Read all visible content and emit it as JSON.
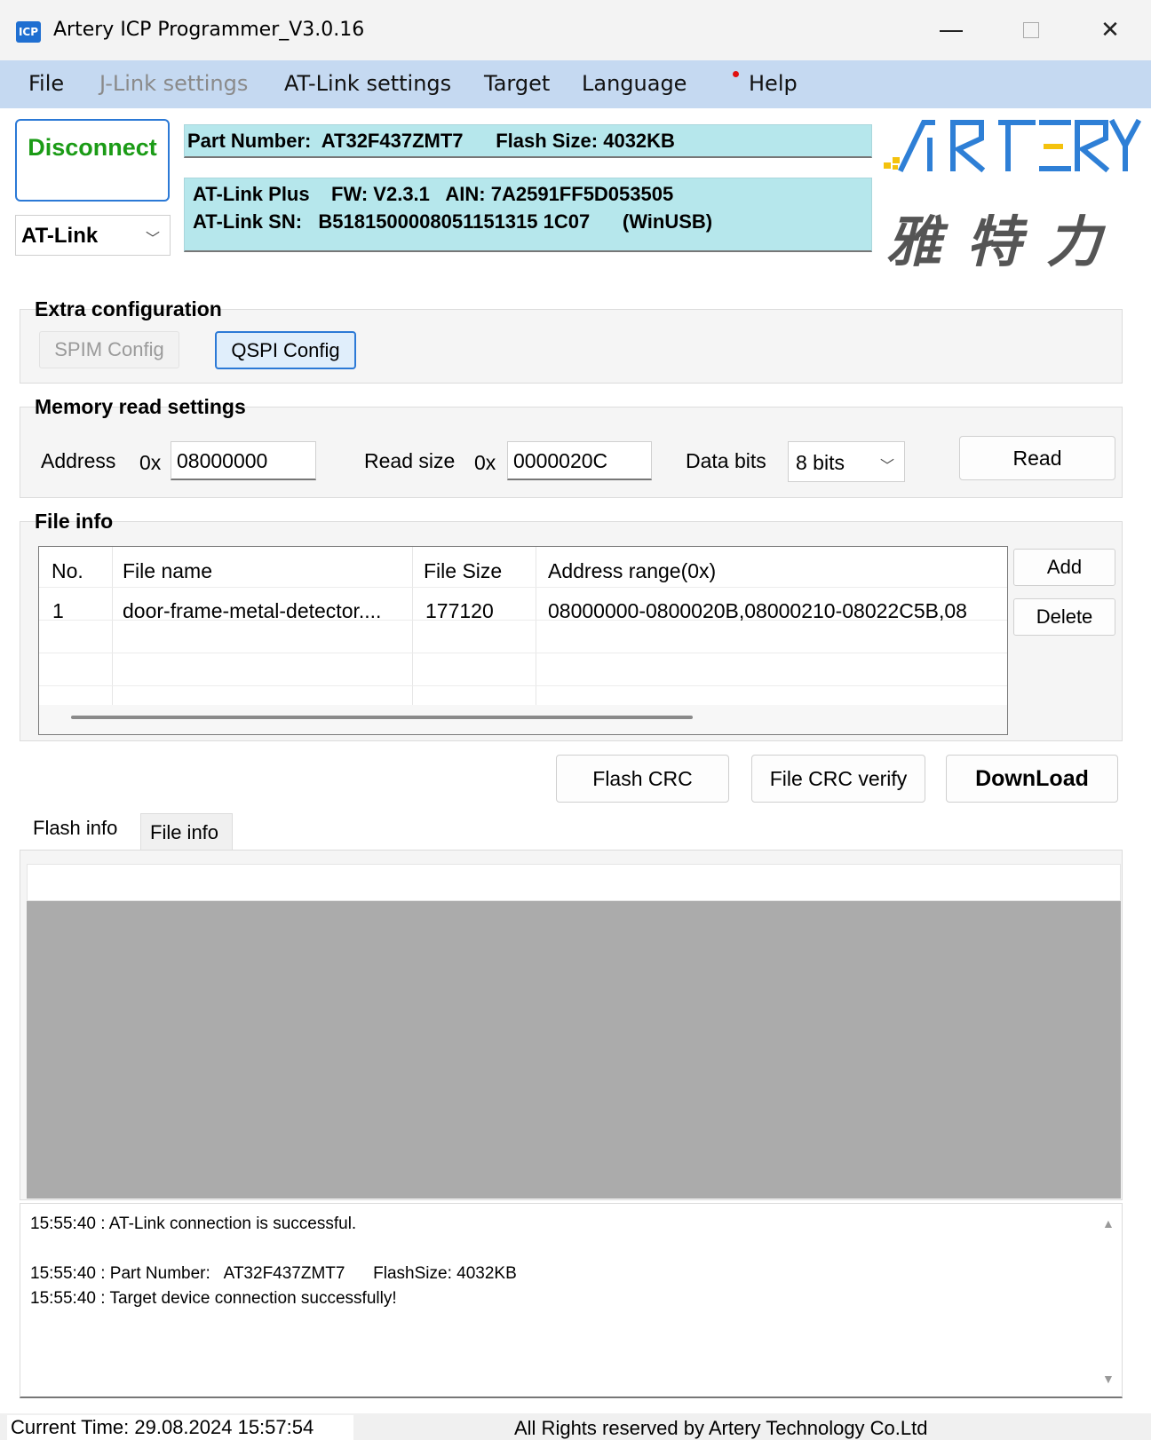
{
  "window": {
    "icon_text": "ICP",
    "title": "Artery ICP Programmer_V3.0.16",
    "minimize_glyph": "—",
    "maximize_glyph": "☐",
    "close_glyph": "✕"
  },
  "menu": {
    "items": [
      {
        "label": "File",
        "enabled": true
      },
      {
        "label": "J-Link settings",
        "enabled": false
      },
      {
        "label": "AT-Link settings",
        "enabled": true
      },
      {
        "label": "Target",
        "enabled": true
      },
      {
        "label": "Language",
        "enabled": true
      },
      {
        "label": "Help",
        "enabled": true
      }
    ]
  },
  "connection": {
    "disconnect_label": "Disconnect",
    "probe_selected": "AT-Link",
    "part_info": "Part Number:  AT32F437ZMT7      Flash Size: 4032KB",
    "link_info_1": "AT-Link Plus    FW: V2.3.1   AIN: 7A2591FF5D053505",
    "link_info_2": "AT-Link SN:   B5181500008051151315 1C07      (WinUSB)",
    "logo_text": "雅特力"
  },
  "extra_config": {
    "title": "Extra configuration",
    "spim_label": "SPIM Config",
    "qspi_label": "QSPI Config"
  },
  "memory_read": {
    "title": "Memory read settings",
    "address_label": "Address",
    "address_prefix": "0x",
    "address_value": "08000000",
    "size_label": "Read size",
    "size_prefix": "0x",
    "size_value": "0000020C",
    "bits_label": "Data bits",
    "bits_value": "8 bits",
    "read_label": "Read"
  },
  "file_info": {
    "title": "File info",
    "columns": [
      "No.",
      "File name",
      "File Size",
      "Address range(0x)"
    ],
    "rows": [
      [
        "1",
        "door-frame-metal-detector....",
        "177120",
        "08000000-0800020B,08000210-08022C5B,08"
      ]
    ],
    "add_label": "Add",
    "delete_label": "Delete"
  },
  "actions": {
    "flash_crc": "Flash CRC",
    "file_crc_verify": "File CRC verify",
    "download": "DownLoad"
  },
  "tabs": {
    "flash_info": "Flash info",
    "file_info": "File info"
  },
  "log": {
    "lines": [
      "15:55:40 : AT-Link connection is successful.",
      "",
      "15:55:40 : Part Number:   AT32F437ZMT7      FlashSize: 4032KB",
      "15:55:40 : Target device connection successfully!"
    ]
  },
  "status": {
    "current_time": "Current Time: 29.08.2024 15:57:54",
    "copyright": "All Rights reserved by Artery Technology Co.Ltd"
  },
  "colors": {
    "menubar": "#c5d9f1",
    "info_panel": "#b6e7ec",
    "disconnect_text": "#1b9b16",
    "accent": "#2b79d6",
    "logo_blue": "#2e7fd6",
    "logo_yellow": "#f4c20d"
  }
}
